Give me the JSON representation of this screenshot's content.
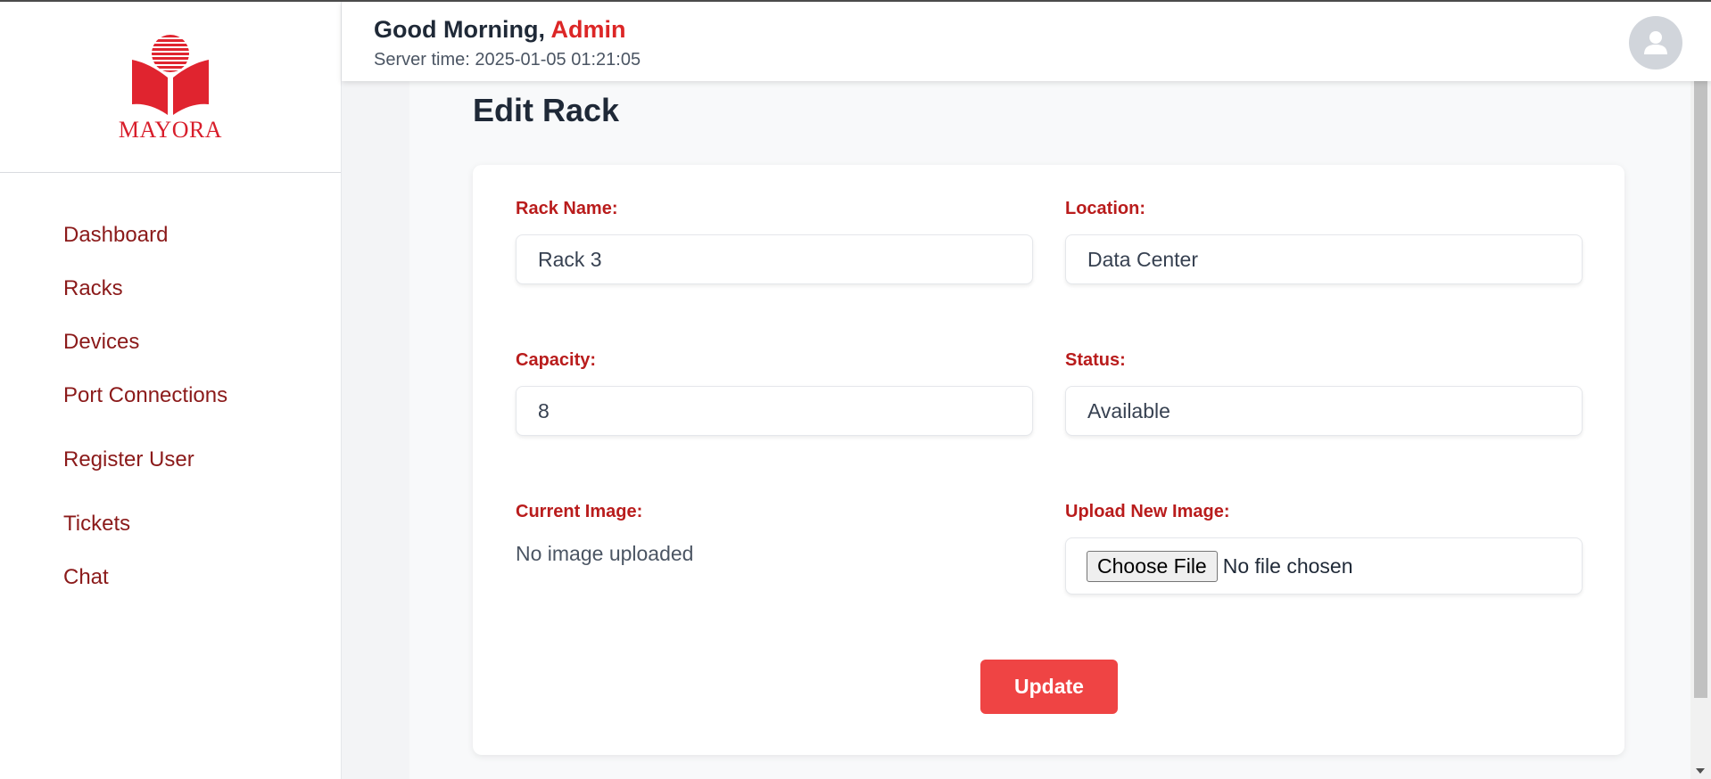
{
  "brand": {
    "logo_text": "MAYORA",
    "color": "#d81e2b"
  },
  "sidebar": {
    "items": [
      {
        "label": "Dashboard"
      },
      {
        "label": "Racks"
      },
      {
        "label": "Devices"
      },
      {
        "label": "Port Connections"
      },
      {
        "label": "Register User"
      },
      {
        "label": "Tickets"
      },
      {
        "label": "Chat"
      }
    ]
  },
  "header": {
    "greeting_prefix": "Good Morning,",
    "user_name": "Admin",
    "server_time": "Server time: 2025-01-05 01:21:05",
    "avatar_icon": "user-avatar-icon"
  },
  "page": {
    "title": "Edit Rack"
  },
  "form": {
    "rack_name_label": "Rack Name:",
    "rack_name_value": "Rack 3",
    "location_label": "Location:",
    "location_value": "Data Center",
    "capacity_label": "Capacity:",
    "capacity_value": "8",
    "status_label": "Status:",
    "status_value": "Available",
    "current_image_label": "Current Image:",
    "current_image_value": "No image uploaded",
    "upload_label": "Upload New Image:",
    "choose_file_label": "Choose File",
    "file_status": "No file chosen",
    "update_label": "Update"
  },
  "colors": {
    "accent": "#ef4444",
    "label": "#b91c1c",
    "nav": "#8b1a1a"
  }
}
